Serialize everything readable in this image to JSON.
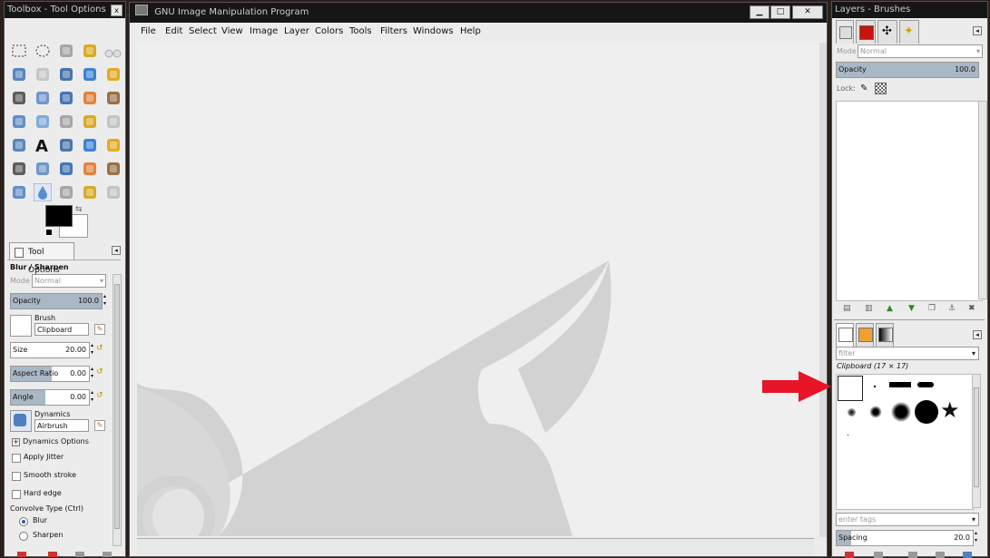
{
  "toolbox": {
    "title": "Toolbox - Tool Options",
    "close_label": "x",
    "tools": [
      "rect-select",
      "ellipse-select",
      "free-select",
      "fuzzy-select",
      "wilber-logo",
      "select-by-color",
      "scissors-select",
      "foreground-select",
      "paths",
      "color-picker",
      "zoom",
      "measure",
      "move",
      "align",
      "crop",
      "rotate",
      "scale",
      "shear",
      "perspective",
      "flip",
      "cage-transform",
      "text",
      "heal",
      "blend",
      "pencil",
      "paintbrush",
      "eraser",
      "airbrush",
      "ink",
      "clone",
      "perspective-clone",
      "blur-sharpen",
      "smudge",
      "dodge-burn",
      "unified-transform"
    ],
    "tool_options_tab": "Tool Options",
    "tool_name": "Blur / Sharpen",
    "mode_label": "Mode",
    "mode_value": "Normal",
    "opacity_label": "Opacity",
    "opacity_value": "100.0",
    "opacity_level": 1.0,
    "brush_label": "Brush",
    "brush_value": "Clipboard",
    "size_label": "Size",
    "size_value": "20.00",
    "aspect_label": "Aspect Ratio",
    "aspect_value": "0.00",
    "angle_label": "Angle",
    "angle_value": "0.00",
    "dynamics_label": "Dynamics",
    "dynamics_value": "Airbrush",
    "dynamics_options": "Dynamics Options",
    "apply_jitter": "Apply Jitter",
    "smooth_stroke": "Smooth stroke",
    "hard_edge": "Hard edge",
    "convolve_type": "Convolve Type  (Ctrl)",
    "blur": "Blur",
    "sharpen": "Sharpen"
  },
  "main": {
    "title": "GNU Image Manipulation Program",
    "menus": [
      "File",
      "Edit",
      "Select",
      "View",
      "Image",
      "Layer",
      "Colors",
      "Tools",
      "Filters",
      "Windows",
      "Help"
    ]
  },
  "layers": {
    "title": "Layers - Brushes",
    "mode_label": "Mode",
    "mode_value": "Normal",
    "opacity_label": "Opacity",
    "opacity_value": "100.0",
    "lock_label": "Lock:",
    "filter_placeholder": "filter",
    "brush_name": "Clipboard (17 × 17)",
    "tags_placeholder": "enter tags",
    "spacing_label": "Spacing",
    "spacing_value": "20.0"
  },
  "colors": {
    "accent": "#e8142a",
    "slider_fill": "#aab7c4",
    "canvas": "#efefef",
    "wilber": "#d2d2d2"
  }
}
